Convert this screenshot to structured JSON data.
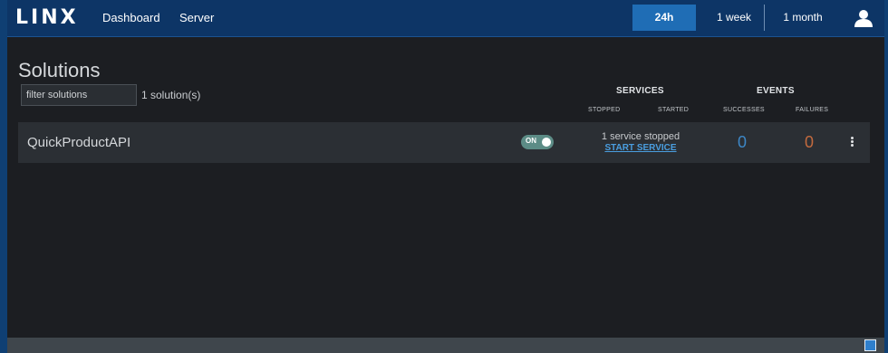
{
  "header": {
    "logo": "LINX",
    "nav": [
      "Dashboard",
      "Server"
    ],
    "time_ranges": [
      "24h",
      "1 week",
      "1 month"
    ],
    "selected_range": "24h",
    "user_icon": "user-icon"
  },
  "page": {
    "title": "Solutions",
    "filter_placeholder": "filter solutions",
    "solution_count": "1 solution(s)"
  },
  "columns": {
    "services": "SERVICES",
    "events": "EVENTS",
    "stopped": "STOPPED",
    "started": "STARTED",
    "successes": "SUCCESSES",
    "failures": "FAILURES"
  },
  "solutions": [
    {
      "name": "QuickProductAPI",
      "toggle_label": "ON",
      "service_status": "1 service stopped",
      "service_action": "START SERVICE",
      "successes": "0",
      "failures": "0"
    }
  ],
  "colors": {
    "header_bg": "#0d3566",
    "active_range": "#1f6db5",
    "success": "#3d87c6",
    "failure": "#c36a3e",
    "toggle_on": "#5c8c86",
    "link": "#4a9ee0"
  }
}
